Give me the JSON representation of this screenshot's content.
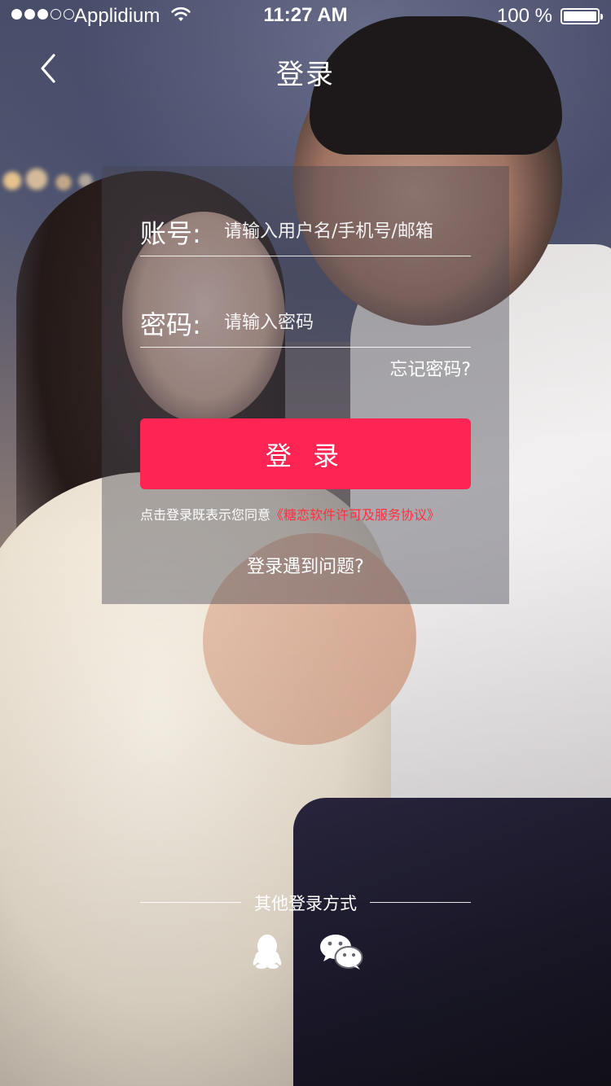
{
  "status_bar": {
    "carrier": "Applidium",
    "time": "11:27 AM",
    "battery": "100 %",
    "signal_icon": "signal-dots-icon",
    "wifi_icon": "wifi-icon",
    "battery_icon": "battery-icon"
  },
  "nav": {
    "title": "登录",
    "back_icon": "chevron-left-icon"
  },
  "form": {
    "account_label": "账号:",
    "account_placeholder": "请输入用户名/手机号/邮箱",
    "password_label": "密码:",
    "password_placeholder": "请输入密码",
    "forgot_password": "忘记密码?",
    "login_button": "登 录",
    "agreement_prefix": "点击登录既表示您同意",
    "agreement_link": "《糖恋软件许可及服务协议》",
    "trouble": "登录遇到问题?"
  },
  "other_login": {
    "label": "其他登录方式",
    "methods": [
      {
        "icon": "qq-icon"
      },
      {
        "icon": "wechat-icon"
      }
    ]
  },
  "colors": {
    "accent": "#fe2552",
    "link": "#ff3040",
    "panel": "rgba(70,70,80,0.42)"
  }
}
